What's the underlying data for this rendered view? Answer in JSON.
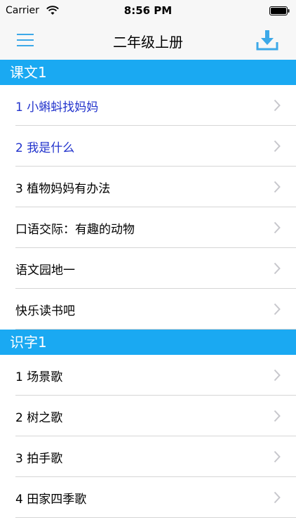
{
  "status_bar": {
    "carrier": "Carrier",
    "time": "8:56 PM"
  },
  "nav": {
    "title": "二年级上册",
    "menu_icon": "menu-icon",
    "download_icon": "download-icon",
    "accent_color": "#3da9e8"
  },
  "sections": [
    {
      "title": "课文1",
      "items": [
        {
          "label": "1 小蝌蚪找妈妈",
          "highlight": true
        },
        {
          "label": "2 我是什么",
          "highlight": true
        },
        {
          "label": "3 植物妈妈有办法",
          "highlight": false
        },
        {
          "label": "口语交际：有趣的动物",
          "highlight": false
        },
        {
          "label": "语文园地一",
          "highlight": false
        },
        {
          "label": "快乐读书吧",
          "highlight": false
        }
      ]
    },
    {
      "title": "识字1",
      "items": [
        {
          "label": "1 场景歌",
          "highlight": false
        },
        {
          "label": "2 树之歌",
          "highlight": false
        },
        {
          "label": "3 拍手歌",
          "highlight": false
        },
        {
          "label": "4 田家四季歌",
          "highlight": false
        }
      ]
    }
  ],
  "colors": {
    "section_header": "#1aa9f2",
    "highlight_text": "#2233cc",
    "separator": "#d6d6d6"
  }
}
